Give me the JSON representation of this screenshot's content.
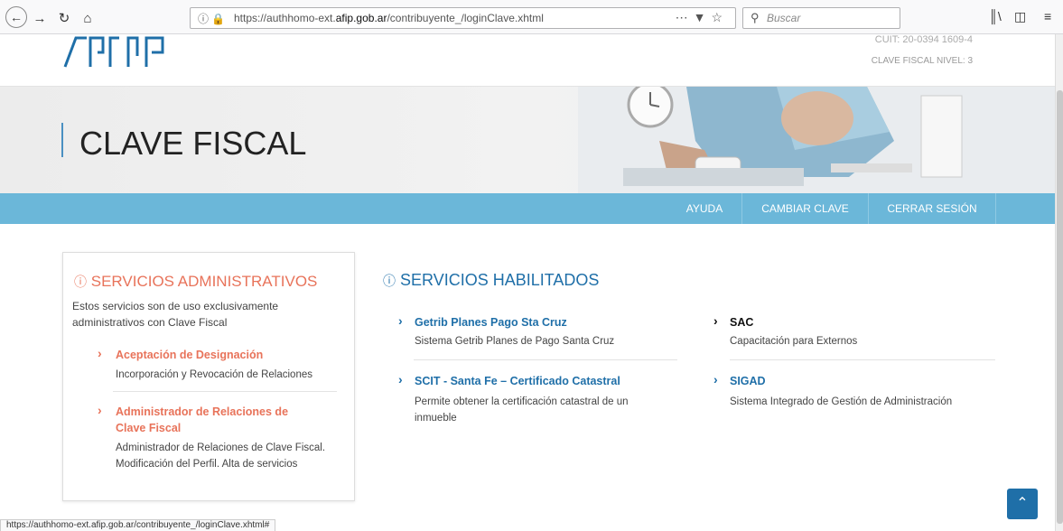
{
  "browser": {
    "back_icon": "back-arrow-icon",
    "forward_icon": "forward-arrow-icon",
    "url_prefix": "https://authhomo-ext.",
    "url_domain": "afip.gob.ar",
    "url_path": "/contribuyente_/loginClave.xhtml",
    "search_placeholder": "Buscar",
    "status_url": "https://authhomo-ext.afip.gob.ar/contribuyente_/loginClave.xhtml#"
  },
  "header": {
    "cuit": "CUIT: 20-0394 1609-4",
    "nivel": "CLAVE FISCAL NIVEL: 3"
  },
  "hero": {
    "title": "CLAVE FISCAL"
  },
  "nav": {
    "items": [
      {
        "label": "AYUDA"
      },
      {
        "label": "CAMBIAR CLAVE"
      },
      {
        "label": "CERRAR SESIÓN"
      }
    ]
  },
  "admin": {
    "title": "SERVICIOS ADMINISTRATIVOS",
    "description": "Estos servicios son de uso exclusivamente administrativos con Clave Fiscal",
    "services": [
      {
        "name": "Aceptación de Designación",
        "desc": "Incorporación y Revocación de Relaciones"
      },
      {
        "name": "Administrador de Relaciones de Clave Fiscal",
        "desc": "Administrador de Relaciones de Clave Fiscal. Modificación del Perfil. Alta de servicios"
      }
    ]
  },
  "habilitados": {
    "title": "SERVICIOS HABILITADOS",
    "services": [
      {
        "name": "Getrib Planes Pago Sta Cruz",
        "desc": "Sistema Getrib Planes de Pago Santa Cruz"
      },
      {
        "name": "SAC",
        "desc": "Capacitación para Externos"
      },
      {
        "name": "SCIT - Santa Fe – Certificado Catastral",
        "desc": "Permite obtener la certificación catastral de un inmueble"
      },
      {
        "name": "SIGAD",
        "desc": "Sistema Integrado de Gestión de Administración"
      }
    ]
  },
  "colors": {
    "accent_blue": "#1f6fa8",
    "accent_orange": "#e8735a",
    "nav_bg": "#6bb7d9"
  }
}
